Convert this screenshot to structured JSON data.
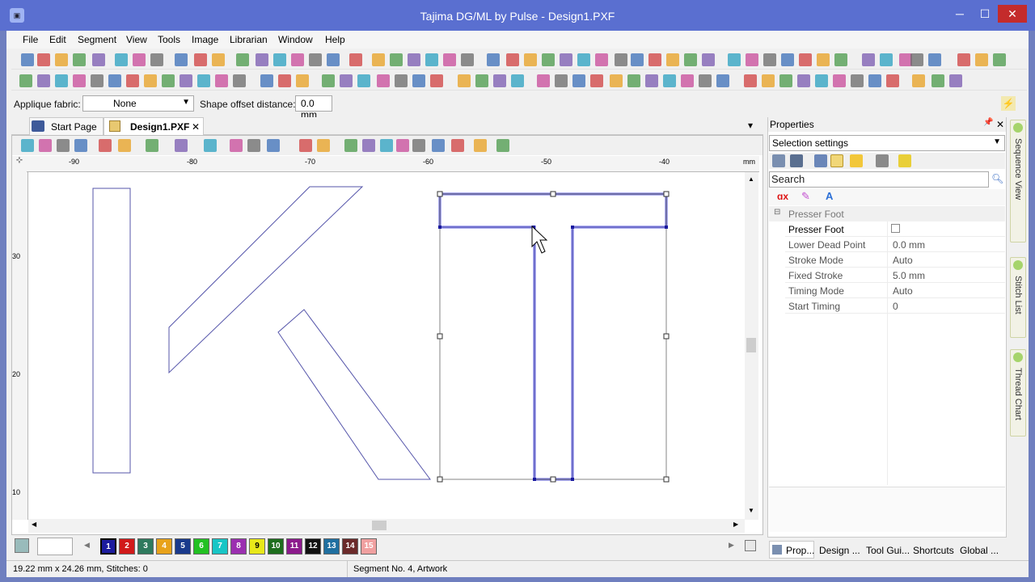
{
  "window": {
    "title": "Tajima DG/ML by Pulse - Design1.PXF",
    "app_icon": "app-logo-icon",
    "min": "─",
    "max": "☐",
    "close": "✕"
  },
  "menu": [
    "File",
    "Edit",
    "Segment",
    "View",
    "Tools",
    "Image",
    "Librarian",
    "Window",
    "Help"
  ],
  "options": {
    "applique_label": "Applique fabric:",
    "applique_value": "None",
    "offset_label": "Shape offset distance:",
    "offset_value": "0.0 mm"
  },
  "tabs": {
    "start": "Start Page",
    "design": "Design1.PXF",
    "close": "✕",
    "dropdown": "▾"
  },
  "ruler": {
    "top": [
      "-90",
      "-80",
      "-70",
      "-60",
      "-50",
      "-40",
      "mm"
    ],
    "left": [
      "30",
      "20",
      "10"
    ]
  },
  "palette": [
    {
      "n": "1",
      "c": "#1b1b9e"
    },
    {
      "n": "2",
      "c": "#d11a1a"
    },
    {
      "n": "3",
      "c": "#2e7a5e"
    },
    {
      "n": "4",
      "c": "#e8a21a"
    },
    {
      "n": "5",
      "c": "#1a3a8c"
    },
    {
      "n": "6",
      "c": "#22c122"
    },
    {
      "n": "7",
      "c": "#18c6c6"
    },
    {
      "n": "8",
      "c": "#9b2fb0"
    },
    {
      "n": "9",
      "c": "#e8e81a"
    },
    {
      "n": "10",
      "c": "#1d6e1d"
    },
    {
      "n": "11",
      "c": "#8c1a8c"
    },
    {
      "n": "12",
      "c": "#111111"
    },
    {
      "n": "13",
      "c": "#1f6fa0"
    },
    {
      "n": "14",
      "c": "#6b2a2a"
    },
    {
      "n": "15",
      "c": "#f0a0a0"
    }
  ],
  "status": {
    "left": "19.22 mm x 24.26 mm, Stitches: 0",
    "right": "Segment No. 4, Artwork"
  },
  "properties": {
    "title": "Properties",
    "pin": "📌",
    "close": "✕",
    "selector": "Selection settings",
    "search_placeholder": "Search",
    "group": "Presser Foot",
    "rows": [
      {
        "name": "Presser Foot",
        "value": ""
      },
      {
        "name": "Lower Dead Point",
        "value": "0.0 mm"
      },
      {
        "name": "Stroke Mode",
        "value": "Auto"
      },
      {
        "name": "Fixed Stroke",
        "value": "5.0 mm"
      },
      {
        "name": "Timing Mode",
        "value": "Auto"
      },
      {
        "name": "Start Timing",
        "value": "0"
      }
    ]
  },
  "side_tabs": [
    "Sequence View",
    "Stitch List",
    "Thread Chart"
  ],
  "bottom_tabs": [
    "Prop...",
    "Design ...",
    "Tool Gui...",
    "Shortcuts",
    "Global ..."
  ],
  "colors": {
    "selection": "#8c8ce8",
    "outline": "#5555aa",
    "close_red": "#c42b2b"
  }
}
